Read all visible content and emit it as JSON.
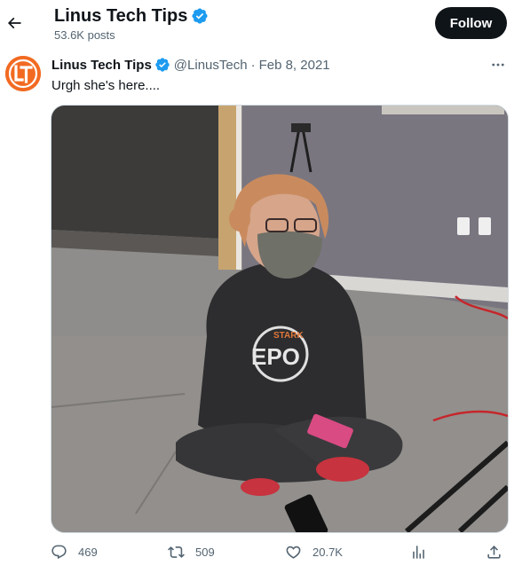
{
  "header": {
    "title": "Linus Tech Tips",
    "post_count": "53.6K posts",
    "follow_label": "Follow"
  },
  "tweet": {
    "author_name": "Linus Tech Tips",
    "handle": "@LinusTech",
    "separator": "·",
    "date": "Feb 8, 2021",
    "text": "Urgh she's here....",
    "media": {
      "description": "photo",
      "hoodie_text": "STARK EXPO"
    },
    "stats": {
      "replies": "469",
      "reposts": "509",
      "likes": "20.7K"
    }
  },
  "colors": {
    "verified": "#1d9bf0",
    "muted": "#536471",
    "text": "#0f1419",
    "follow_bg": "#0f1419",
    "avatar": "#f26a21"
  },
  "icons": [
    "back-arrow-icon",
    "verified-badge-icon",
    "more-icon",
    "reply-icon",
    "repost-icon",
    "like-icon",
    "views-icon",
    "share-icon"
  ]
}
